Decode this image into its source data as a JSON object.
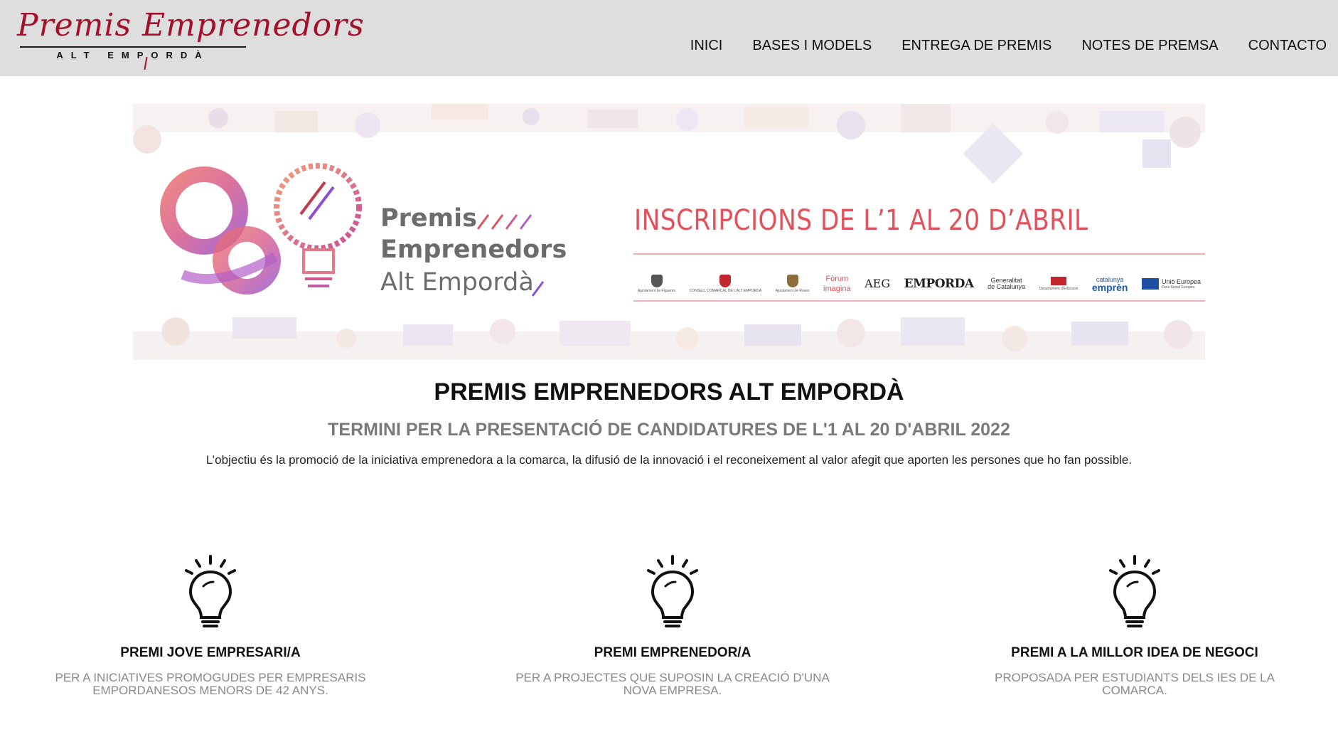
{
  "header": {
    "logo_script": "Premis Emprenedors",
    "logo_sub": "ALT EMPORDÀ",
    "nav": [
      "INICI",
      "BASES I MODELS",
      "ENTREGA DE PREMIS",
      "NOTES DE PREMSA",
      "CONTACTO"
    ]
  },
  "banner": {
    "word1": "Premis",
    "word2": "Emprenedors",
    "word3": "Alt Empordà",
    "headline": "INSCRIPCIONS DE L’1 AL 20 D’ABRIL",
    "sponsors": {
      "figueres": "Ajuntament de Figueres",
      "consell": "CONSELL COMARCAL DE L'ALT EMPORDÀ",
      "roses": "Ajuntament de Roses",
      "forum_1": "Fòrum",
      "forum_2": "imagina",
      "aeg": "AEG",
      "emporda": "EMPORDA",
      "generalitat_1": "Generalitat",
      "generalitat_2": "de Catalunya",
      "educacio": "Departament d'Educació",
      "catalunya_1": "catalunya",
      "catalunya_2": "emprèn",
      "ue_1": "Unió Europea",
      "ue_2": "Fons Social Europeu"
    }
  },
  "main": {
    "title": "PREMIS EMPRENEDORS ALT EMPORDÀ",
    "subtitle": "TERMINI PER LA PRESENTACIÓ DE CANDIDATURES DE L'1 AL 20 D'ABRIL 2022",
    "intro": "L’objectiu és la promoció de la iniciativa emprenedora a la comarca, la difusió de la innovació i el reconeixement al valor afegit que aporten les persones que ho fan possible."
  },
  "features": [
    {
      "icon": "lightbulb-icon",
      "title": "PREMI JOVE EMPRESARI/A",
      "desc": "PER A INICIATIVES PROMOGUDES PER EMPRESARIS EMPORDANESOS MENORS DE 42 ANYS."
    },
    {
      "icon": "lightbulb-icon",
      "title": "PREMI EMPRENEDOR/A",
      "desc": "PER A PROJECTES QUE SUPOSIN LA CREACIÓ D'UNA NOVA EMPRESA."
    },
    {
      "icon": "lightbulb-icon",
      "title": "PREMI A LA MILLOR IDEA DE NEGOCI",
      "desc": "PROPOSADA PER ESTUDIANTS DELS IES DE LA COMARCA."
    }
  ],
  "colors": {
    "header_bg": "#dedede",
    "logo_red": "#a40f2a",
    "banner_headline": "#e0525c",
    "subtitle_gray": "#7a7a7a"
  }
}
